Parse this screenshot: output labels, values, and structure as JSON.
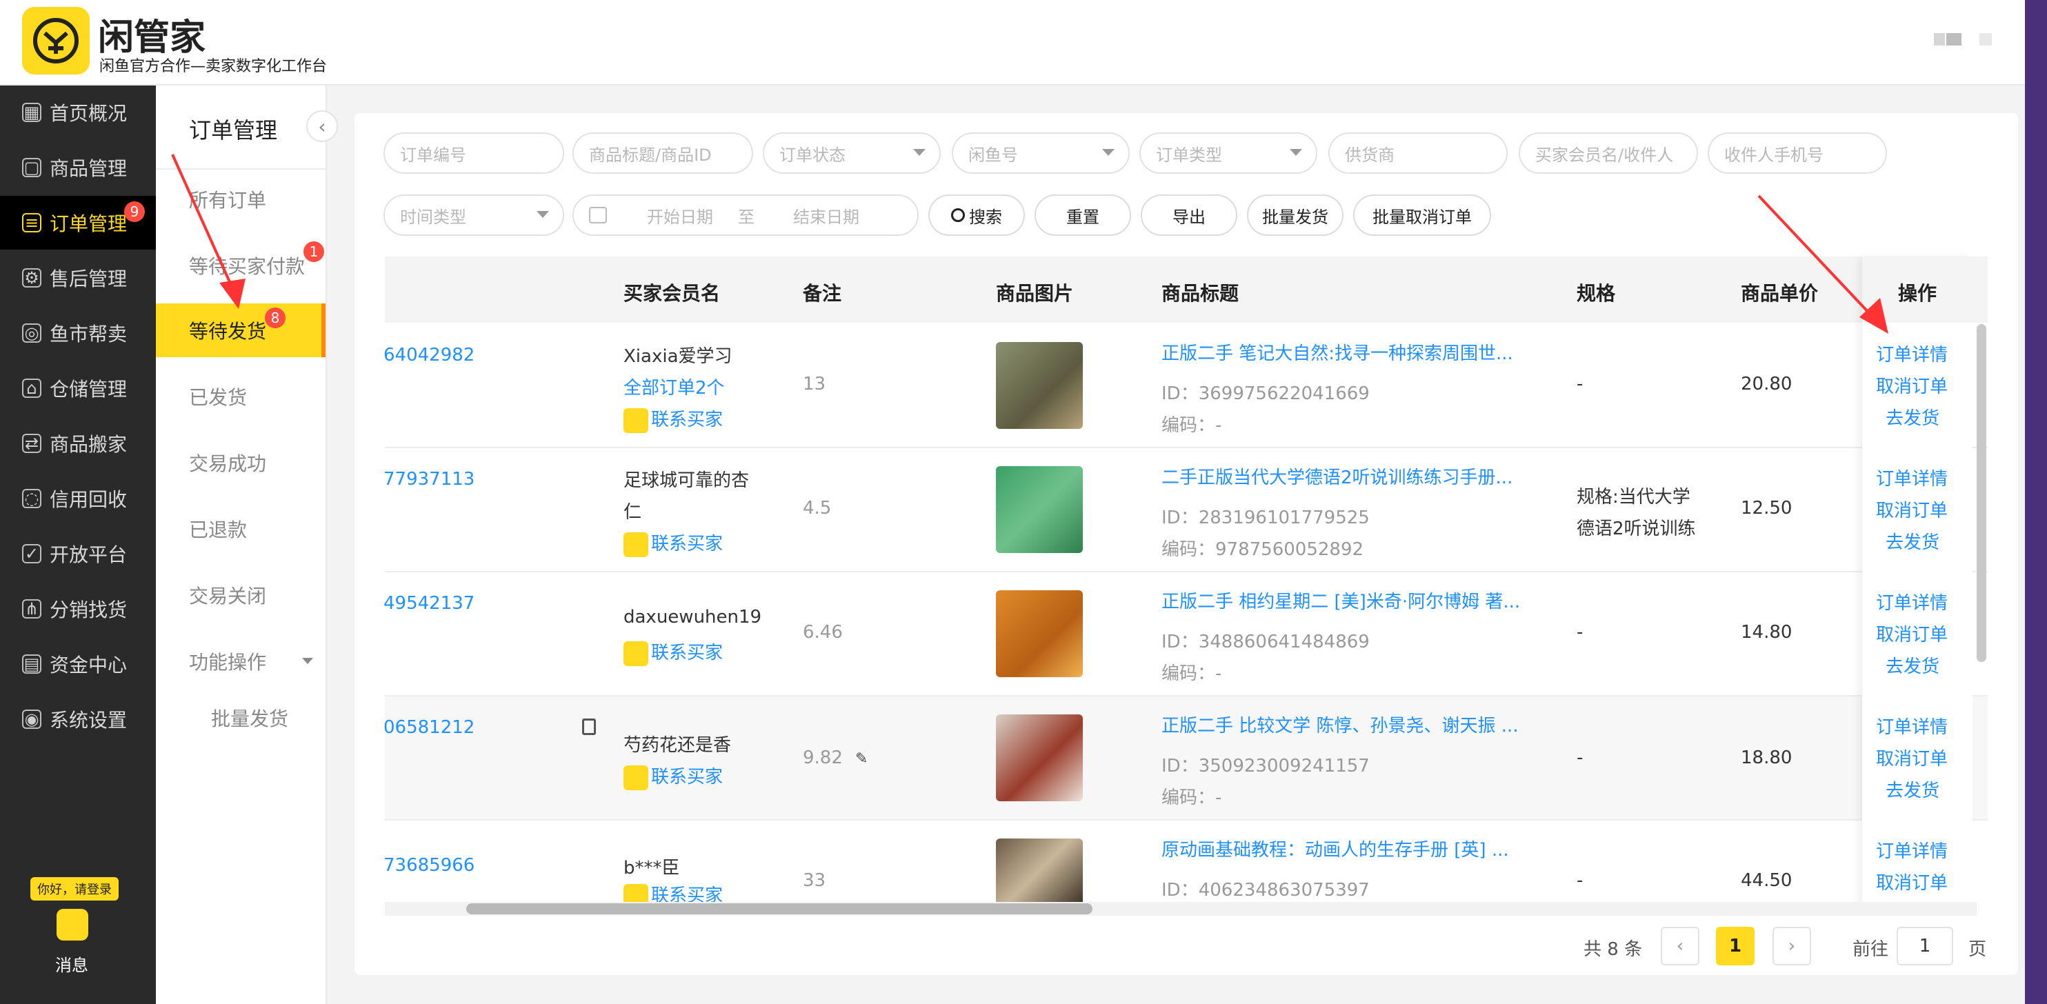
{
  "header": {
    "app_name": "闲管家",
    "subtitle": "闲鱼官方合作—卖家数字化工作台"
  },
  "sidebar": {
    "items": [
      {
        "label": "首页概况",
        "icon": "grid-icon"
      },
      {
        "label": "商品管理",
        "icon": "bag-icon"
      },
      {
        "label": "订单管理",
        "icon": "order-icon",
        "badge": "9"
      },
      {
        "label": "售后管理",
        "icon": "service-icon"
      },
      {
        "label": "鱼市帮卖",
        "icon": "fish-icon"
      },
      {
        "label": "仓储管理",
        "icon": "warehouse-icon"
      },
      {
        "label": "商品搬家",
        "icon": "move-icon"
      },
      {
        "label": "信用回收",
        "icon": "recycle-icon"
      },
      {
        "label": "开放平台",
        "icon": "open-icon"
      },
      {
        "label": "分销找货",
        "icon": "share-icon"
      },
      {
        "label": "资金中心",
        "icon": "wallet-icon"
      },
      {
        "label": "系统设置",
        "icon": "settings-icon"
      }
    ],
    "login_tip": "你好，请登录",
    "message_label": "消息"
  },
  "subnav": {
    "title": "订单管理",
    "items": [
      {
        "label": "所有订单"
      },
      {
        "label": "等待买家付款",
        "badge": "1"
      },
      {
        "label": "等待发货",
        "badge": "8"
      },
      {
        "label": "已发货"
      },
      {
        "label": "交易成功"
      },
      {
        "label": "已退款"
      },
      {
        "label": "交易关闭"
      },
      {
        "label": "功能操作"
      }
    ],
    "sub_item": "批量发货"
  },
  "filters": {
    "order_no": "订单编号",
    "title_id": "商品标题/商品ID",
    "status": "订单状态",
    "xianyu": "闲鱼号",
    "type": "订单类型",
    "supplier": "供货商",
    "buyer": "买家会员名/收件人",
    "phone": "收件人手机号",
    "time_type": "时间类型",
    "start": "开始日期",
    "to": "至",
    "end": "结束日期"
  },
  "buttons": {
    "search": "搜索",
    "reset": "重置",
    "export": "导出",
    "batch_ship": "批量发货",
    "batch_cancel": "批量取消订单"
  },
  "table": {
    "headers": {
      "buyer": "买家会员名",
      "note": "备注",
      "image": "商品图片",
      "title": "商品标题",
      "spec": "规格",
      "price": "商品单价",
      "ops": "操作"
    },
    "rows": [
      {
        "order": "64042982",
        "buyer": "Xiaxia爱学习",
        "buyer2": "全部订单2个",
        "contact": "联系买家",
        "note": "13",
        "title": "正版二手 笔记大自然:找寻一种探索周围世...",
        "id": "ID：369975622041669",
        "code": "编码：-",
        "spec": "-",
        "price": "20.80",
        "op1": "订单详情",
        "op2": "取消订单",
        "op3": "去发货"
      },
      {
        "order": "77937113",
        "buyer": "足球城可靠的杏",
        "buyer2": "仁",
        "contact": "联系买家",
        "note": "4.5",
        "title": "二手正版当代大学德语2听说训练练习手册...",
        "id": "ID：283196101779525",
        "code": "编码：9787560052892",
        "spec": "规格:当代大学",
        "spec2": "德语2听说训练",
        "price": "12.50",
        "op1": "订单详情",
        "op2": "取消订单",
        "op3": "去发货"
      },
      {
        "order": "49542137",
        "buyer": "daxuewuhen19",
        "buyer2": "",
        "contact": "联系买家",
        "note": "6.46",
        "title": "正版二手 相约星期二 [美]米奇·阿尔博姆 著...",
        "id": "ID：348860641484869",
        "code": "编码：-",
        "spec": "-",
        "price": "14.80",
        "op1": "订单详情",
        "op2": "取消订单",
        "op3": "去发货"
      },
      {
        "order": "06581212",
        "buyer": "芍药花还是香",
        "buyer2": "",
        "contact": "联系买家",
        "note": "9.82",
        "title": "正版二手 比较文学 陈惇、孙景尧、谢天振 ...",
        "id": "ID：350923009241157",
        "code": "编码：-",
        "spec": "-",
        "price": "18.80",
        "op1": "订单详情",
        "op2": "取消订单",
        "op3": "去发货"
      },
      {
        "order": "73685966",
        "buyer": "b***臣",
        "buyer2": "",
        "contact": "联系买家",
        "note": "33",
        "title": "原动画基础教程：动画人的生存手册 [英] ...",
        "id": "ID：406234863075397",
        "code": "",
        "spec": "-",
        "price": "44.50",
        "op1": "订单详情",
        "op2": "取消订单",
        "op3": ""
      }
    ]
  },
  "pagination": {
    "total": "共 8 条",
    "prev": "‹",
    "current": "1",
    "next": "›",
    "goto": "前往",
    "goto_value": "1",
    "page": "页"
  },
  "colors": {
    "accent": "#ffda1f",
    "link": "#1e90ff",
    "badge": "#ff4c3e",
    "sidebar": "#2a2a2a"
  }
}
